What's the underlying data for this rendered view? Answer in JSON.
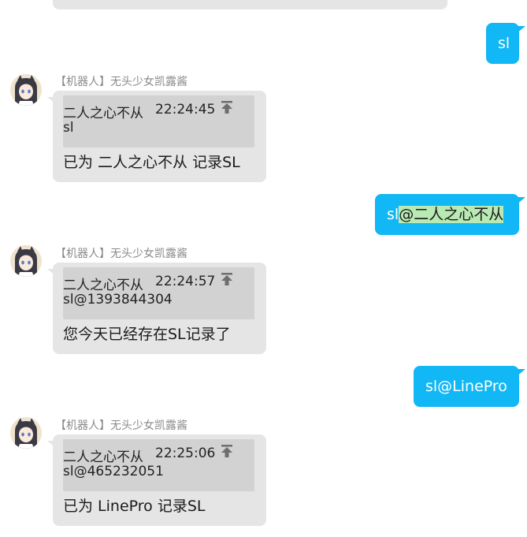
{
  "colors": {
    "self_bubble": "#12b7f5",
    "other_bubble": "#e5e5e5",
    "quote_block": "#d2d2d2",
    "mention_highlight": "#b9eab3",
    "sender_name": "#8a8a8a"
  },
  "icons": {
    "avatar": "anime-girl-avatar-icon",
    "quote_jump": "jump-to-top-icon"
  },
  "messages": [
    {
      "type": "self",
      "text": "sl"
    },
    {
      "type": "bot",
      "sender": "【机器人】无头少女凯露酱",
      "quote": {
        "name": "二人之心不从",
        "time": "22:24:45",
        "text": "sl"
      },
      "text": "已为 二人之心不从 记录SL"
    },
    {
      "type": "self",
      "text_prefix": "sl",
      "mention": "@二人之心不从"
    },
    {
      "type": "bot",
      "sender": "【机器人】无头少女凯露酱",
      "quote": {
        "name": "二人之心不从",
        "time": "22:24:57",
        "text": "sl@1393844304"
      },
      "text": "您今天已经存在SL记录了"
    },
    {
      "type": "self",
      "text": "sl@LinePro"
    },
    {
      "type": "bot",
      "sender": "【机器人】无头少女凯露酱",
      "quote": {
        "name": "二人之心不从",
        "time": "22:25:06",
        "text": "sl@465232051"
      },
      "text": "已为 LinePro 记录SL"
    }
  ]
}
